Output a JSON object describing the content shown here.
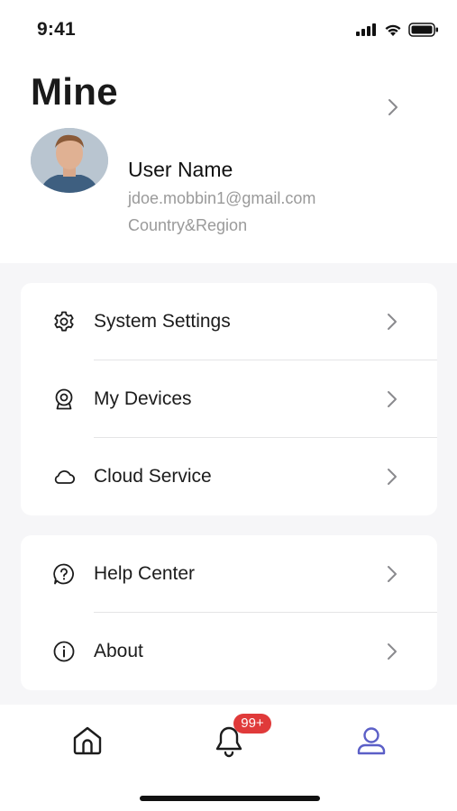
{
  "status_bar": {
    "time": "9:41"
  },
  "header": {
    "title": "Mine",
    "user_name": "User Name",
    "email": "jdoe.mobbin1@gmail.com",
    "region": "Country&Region"
  },
  "menu_groups": [
    {
      "items": [
        {
          "label": "System Settings",
          "icon": "gear-icon"
        },
        {
          "label": "My Devices",
          "icon": "webcam-icon"
        },
        {
          "label": "Cloud Service",
          "icon": "cloud-icon"
        }
      ]
    },
    {
      "items": [
        {
          "label": "Help Center",
          "icon": "help-bubble-icon"
        },
        {
          "label": "About",
          "icon": "info-icon"
        }
      ]
    }
  ],
  "tab_bar": {
    "tabs": [
      {
        "name": "home",
        "icon": "home-icon",
        "active": false
      },
      {
        "name": "notifications",
        "icon": "bell-icon",
        "active": false,
        "badge": "99+"
      },
      {
        "name": "mine",
        "icon": "person-icon",
        "active": true
      }
    ]
  },
  "colors": {
    "accent": "#5b5fc7",
    "badge": "#e03a3a",
    "secondary_text": "#9a9a9a",
    "background_gray": "#f6f6f8"
  }
}
